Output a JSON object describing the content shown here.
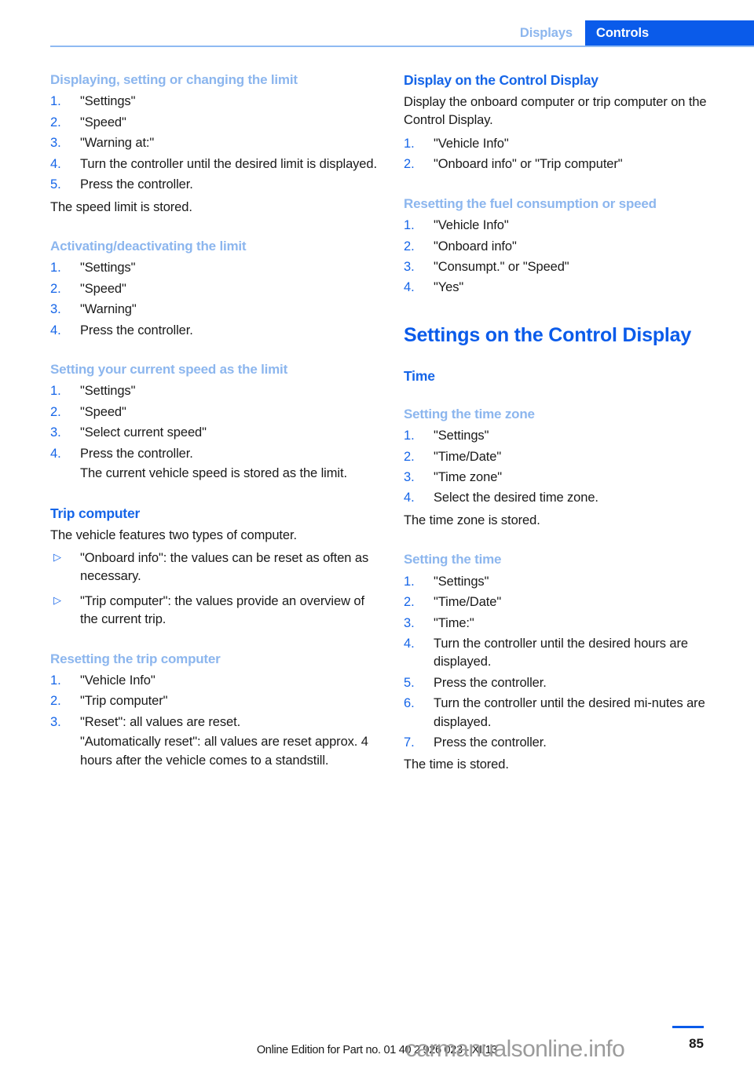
{
  "header": {
    "tab_inactive": "Displays",
    "tab_active": "Controls",
    "accent_blue": "#0a5bea",
    "light_blue": "#8cb6ee",
    "rule_blue": "#8fbaf2"
  },
  "left_column": {
    "sections": [
      {
        "id": "displaying-setting-changing-limit",
        "level": "h4",
        "heading": "Displaying, setting or changing the limit",
        "steps": [
          "\"Settings\"",
          "\"Speed\"",
          "\"Warning at:\"",
          "Turn the controller until the desired limit is displayed.",
          "Press the controller."
        ],
        "after_paragraph": "The speed limit is stored."
      },
      {
        "id": "activating-deactivating-limit",
        "level": "h4",
        "heading": "Activating/deactivating the limit",
        "steps": [
          "\"Settings\"",
          "\"Speed\"",
          "\"Warning\"",
          "Press the controller."
        ]
      },
      {
        "id": "setting-current-speed-as-limit",
        "level": "h4",
        "heading": "Setting your current speed as the limit",
        "steps": [
          "\"Settings\"",
          "\"Speed\"",
          "\"Select current speed\"",
          "Press the controller."
        ],
        "step_substep_index": 3,
        "step_substep": "The current vehicle speed is stored as the limit."
      },
      {
        "id": "trip-computer",
        "level": "h3",
        "heading": "Trip computer",
        "paragraph": "The vehicle features two types of computer.",
        "bullets": [
          "\"Onboard info\": the values can be reset as often as necessary.",
          "\"Trip computer\": the values provide an overview of the current trip."
        ]
      },
      {
        "id": "resetting-trip-computer",
        "level": "h4",
        "heading": "Resetting the trip computer",
        "steps": [
          "\"Vehicle Info\"",
          "\"Trip computer\"",
          "\"Reset\": all values are reset."
        ],
        "step_substep_index": 2,
        "step_substep": "\"Automatically reset\": all values are reset approx. 4 hours after the vehicle comes to a standstill."
      }
    ]
  },
  "right_column": {
    "sections": [
      {
        "id": "display-on-control-display",
        "level": "h3",
        "heading": "Display on the Control Display",
        "paragraph": "Display the onboard computer or trip computer on the Control Display.",
        "steps": [
          "\"Vehicle Info\"",
          "\"Onboard info\" or \"Trip computer\""
        ]
      },
      {
        "id": "resetting-fuel-consumption-or-speed",
        "level": "h4",
        "heading": "Resetting the fuel consumption or speed",
        "steps": [
          "\"Vehicle Info\"",
          "\"Onboard info\"",
          "\"Consumpt.\" or \"Speed\"",
          "\"Yes\""
        ]
      },
      {
        "id": "settings-on-control-display",
        "level": "h2",
        "heading": "Settings on the Control Display"
      },
      {
        "id": "time",
        "level": "h3",
        "heading": "Time"
      },
      {
        "id": "setting-the-time-zone",
        "level": "h4",
        "heading": "Setting the time zone",
        "steps": [
          "\"Settings\"",
          "\"Time/Date\"",
          "\"Time zone\"",
          "Select the desired time zone."
        ],
        "after_paragraph": "The time zone is stored."
      },
      {
        "id": "setting-the-time",
        "level": "h4",
        "heading": "Setting the time",
        "steps": [
          "\"Settings\"",
          "\"Time/Date\"",
          "\"Time:\"",
          "Turn the controller until the desired hours are displayed.",
          "Press the controller.",
          "Turn the controller until the desired mi‑nutes are displayed.",
          "Press the controller."
        ],
        "after_paragraph": "The time is stored."
      }
    ]
  },
  "footer": {
    "edition_note": "Online Edition for Part no. 01 40 2 926 023 - XI/13",
    "watermark": "carmanualsonline.info",
    "page_number": "85"
  }
}
